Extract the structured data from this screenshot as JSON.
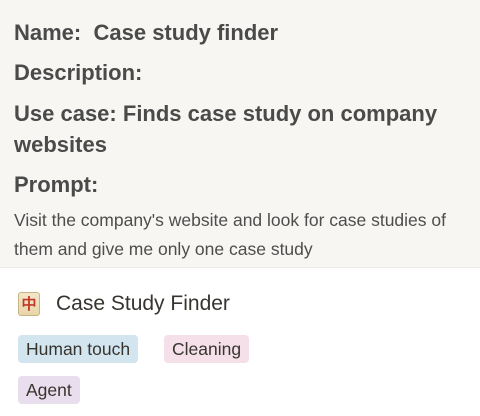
{
  "details": {
    "name_label": "Name:",
    "name_value": "Case study finder",
    "description_label": "Description:",
    "use_case_label": "Use case:",
    "use_case_value": "Finds case study on company websites",
    "prompt_label": "Prompt:",
    "prompt_text": "Visit the company's website and look for case studies of them and give me only one case study"
  },
  "page": {
    "icon": "mahjong-red-dragon-icon",
    "icon_glyph": "中",
    "title": "Case Study Finder"
  },
  "tags": [
    {
      "label": "Human touch",
      "color": "#d3e5ef"
    },
    {
      "label": "Cleaning",
      "color": "#f5e0e9"
    },
    {
      "label": "Agent",
      "color": "#e8deee"
    }
  ]
}
